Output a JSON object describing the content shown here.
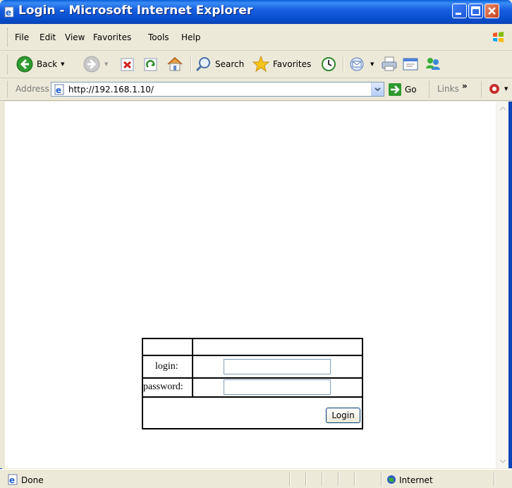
{
  "window": {
    "title": "Login - Microsoft Internet Explorer"
  },
  "menu": {
    "items": [
      "File",
      "Edit",
      "View",
      "Favorites",
      "Tools",
      "Help"
    ]
  },
  "toolbar": {
    "back_label": "Back",
    "search_label": "Search",
    "favorites_label": "Favorites"
  },
  "address": {
    "label": "Address",
    "url": "http://192.168.1.10/",
    "go_label": "Go",
    "links_label": "Links"
  },
  "login_form": {
    "login_label": "login:",
    "password_label": "password:",
    "login_value": "",
    "password_value": "",
    "submit_label": "Login"
  },
  "status": {
    "text": "Done",
    "zone": "Internet"
  },
  "colors": {
    "titlebar": "#0a5fd8",
    "chrome": "#ECE9D8",
    "close_button": "#c8401c"
  }
}
